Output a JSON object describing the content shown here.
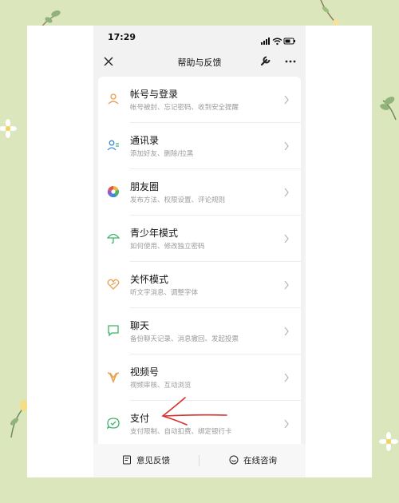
{
  "colors": {
    "background": "#dce6bd",
    "accent_orange": "#e8a04a",
    "accent_blue": "#3b8bd6",
    "accent_green": "#3fb46a",
    "annotation_red": "#d6312d"
  },
  "status_bar": {
    "time": "17:29",
    "icons": [
      "signal-icon",
      "wifi-icon",
      "battery-icon"
    ]
  },
  "nav": {
    "title": "帮助与反馈",
    "close_icon": "close-icon",
    "tool_icon": "wrench-icon",
    "more_icon": "more-icon"
  },
  "items": [
    {
      "title": "帐号与登录",
      "subtitle": "帐号被封、忘记密码、收到安全提醒",
      "icon": "person-icon"
    },
    {
      "title": "通讯录",
      "subtitle": "添加好友、删除/拉黑",
      "icon": "contacts-icon"
    },
    {
      "title": "朋友圈",
      "subtitle": "发布方法、权限设置、评论规则",
      "icon": "moments-icon"
    },
    {
      "title": "青少年模式",
      "subtitle": "如何使用、修改独立密码",
      "icon": "umbrella-icon"
    },
    {
      "title": "关怀模式",
      "subtitle": "听文字消息、调整字体",
      "icon": "heart-icon"
    },
    {
      "title": "聊天",
      "subtitle": "备份聊天记录、消息撤回、发起投票",
      "icon": "chat-icon"
    },
    {
      "title": "视频号",
      "subtitle": "视频审核、互动浏览",
      "icon": "channels-icon"
    },
    {
      "title": "支付",
      "subtitle": "支付限制、自动扣费、绑定银行卡",
      "icon": "pay-icon"
    }
  ],
  "bottom_bar": {
    "feedback_label": "意见反馈",
    "consult_label": "在线咨询"
  }
}
